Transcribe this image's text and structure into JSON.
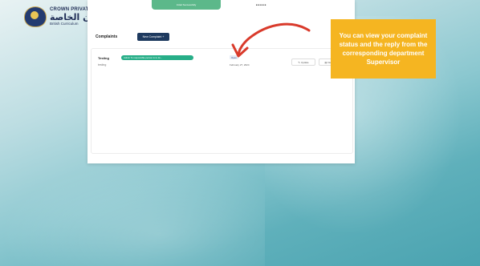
{
  "branding": {
    "school_name_en": "CROWN PRIVATE SCHOOL",
    "school_name_ar": "مدرسة كراون الخاصة",
    "curriculum": "British Curriculum"
  },
  "header": {
    "top_pill": "Initial Successfully",
    "top_misc": "■ ■    ■ ■ ■"
  },
  "page": {
    "title": "Complaints",
    "new_button": "New Complaint +"
  },
  "complaints": [
    {
      "subject": "Testing",
      "department": "Admin To responsible person is to do...",
      "description": "testing",
      "status": "Open",
      "date": "February 27, 2024",
      "update_label": "Update",
      "details_label": "Details"
    }
  ],
  "callout": {
    "text": "You can view your complaint status and the reply from the corresponding department Supervisor",
    "color": "#f5b521"
  },
  "colors": {
    "accent_arrow": "#d93a2b",
    "primary_button": "#1e3a5f",
    "department_tag": "#27ae88"
  }
}
